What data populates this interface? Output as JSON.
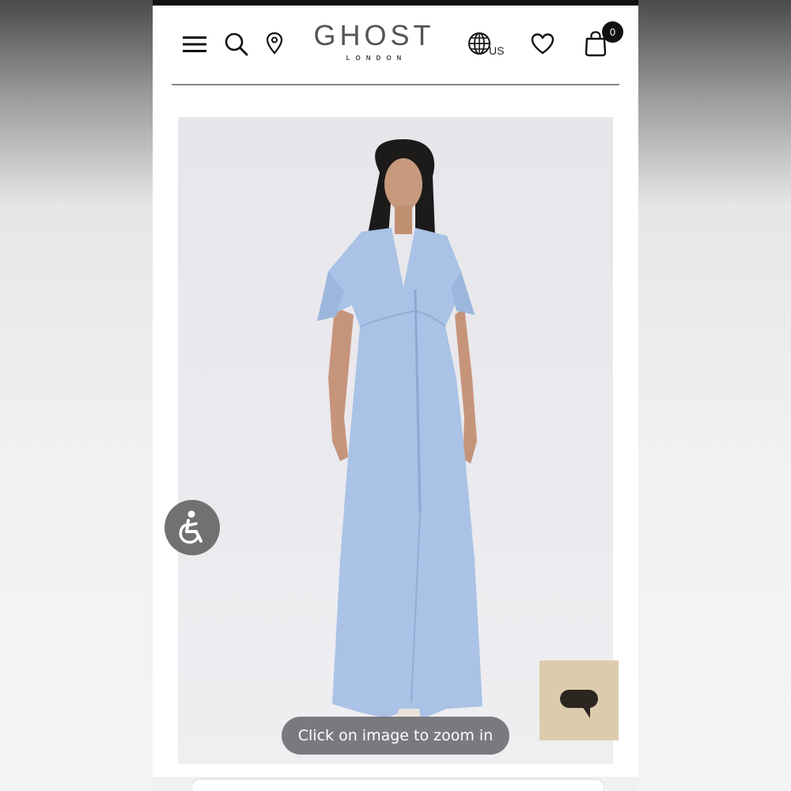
{
  "brand": {
    "name": "GHOST",
    "sub": "LONDON"
  },
  "header": {
    "region": "US",
    "cart_count": "0"
  },
  "icons": {
    "menu": "hamburger-menu-icon",
    "search": "search-icon",
    "store": "location-pin-icon",
    "region": "globe-icon",
    "wishlist": "heart-icon",
    "cart": "shopping-bag-icon",
    "accessibility": "accessibility-icon",
    "chat": "chat-bubble-icon"
  },
  "product": {
    "zoom_hint": "Click on image to zoom in",
    "dress_color": "#a9c2e6"
  },
  "colors": {
    "chat_bg": "#dcccad",
    "accessibility_bg": "#6f7271"
  }
}
